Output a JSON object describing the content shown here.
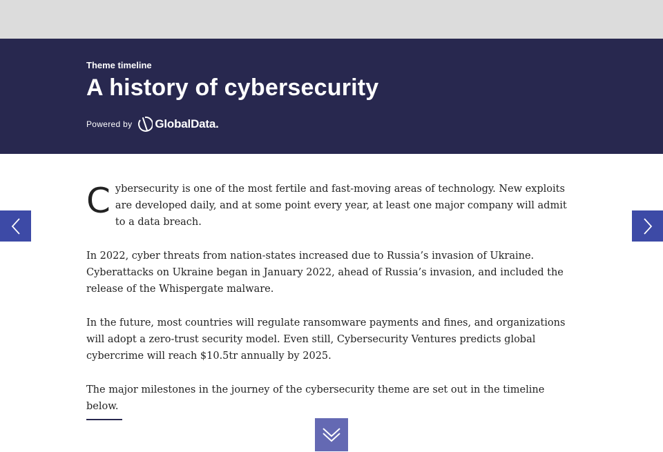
{
  "hero": {
    "kicker": "Theme timeline",
    "title": "A history of cybersecurity",
    "powered_by": "Powered by",
    "brand": "GlobalData."
  },
  "article": {
    "dropcap": "C",
    "p1": "ybersecurity is one of the most fertile and fast-moving areas of technology. New exploits are developed daily, and at some point every year, at least one major company will admit to a data breach.",
    "p2": "In 2022, cyber threats from nation-states increased due to Russia’s invasion of Ukraine. Cyberattacks on Ukraine began in January 2022, ahead of Russia’s invasion, and included the release of the Whispergate malware.",
    "p3": "In the future, most countries will regulate ransomware payments and fines, and organizations will adopt a zero-trust security model. Even still, Cybersecurity Ventures predicts global cybercrime will reach $10.5tr annually by 2025.",
    "p4": "The major milestones in the journey of the cybersecurity theme are set out in the timeline below."
  },
  "controls": {
    "prev_icon": "chevron-left-icon",
    "next_icon": "chevron-right-icon",
    "scroll_icon": "double-chevron-down-icon"
  },
  "colors": {
    "hero_bg": "#28284f",
    "nav_button": "#3d4aa6",
    "scroll_button": "#6469b3",
    "topbar": "#dcdcdc"
  }
}
